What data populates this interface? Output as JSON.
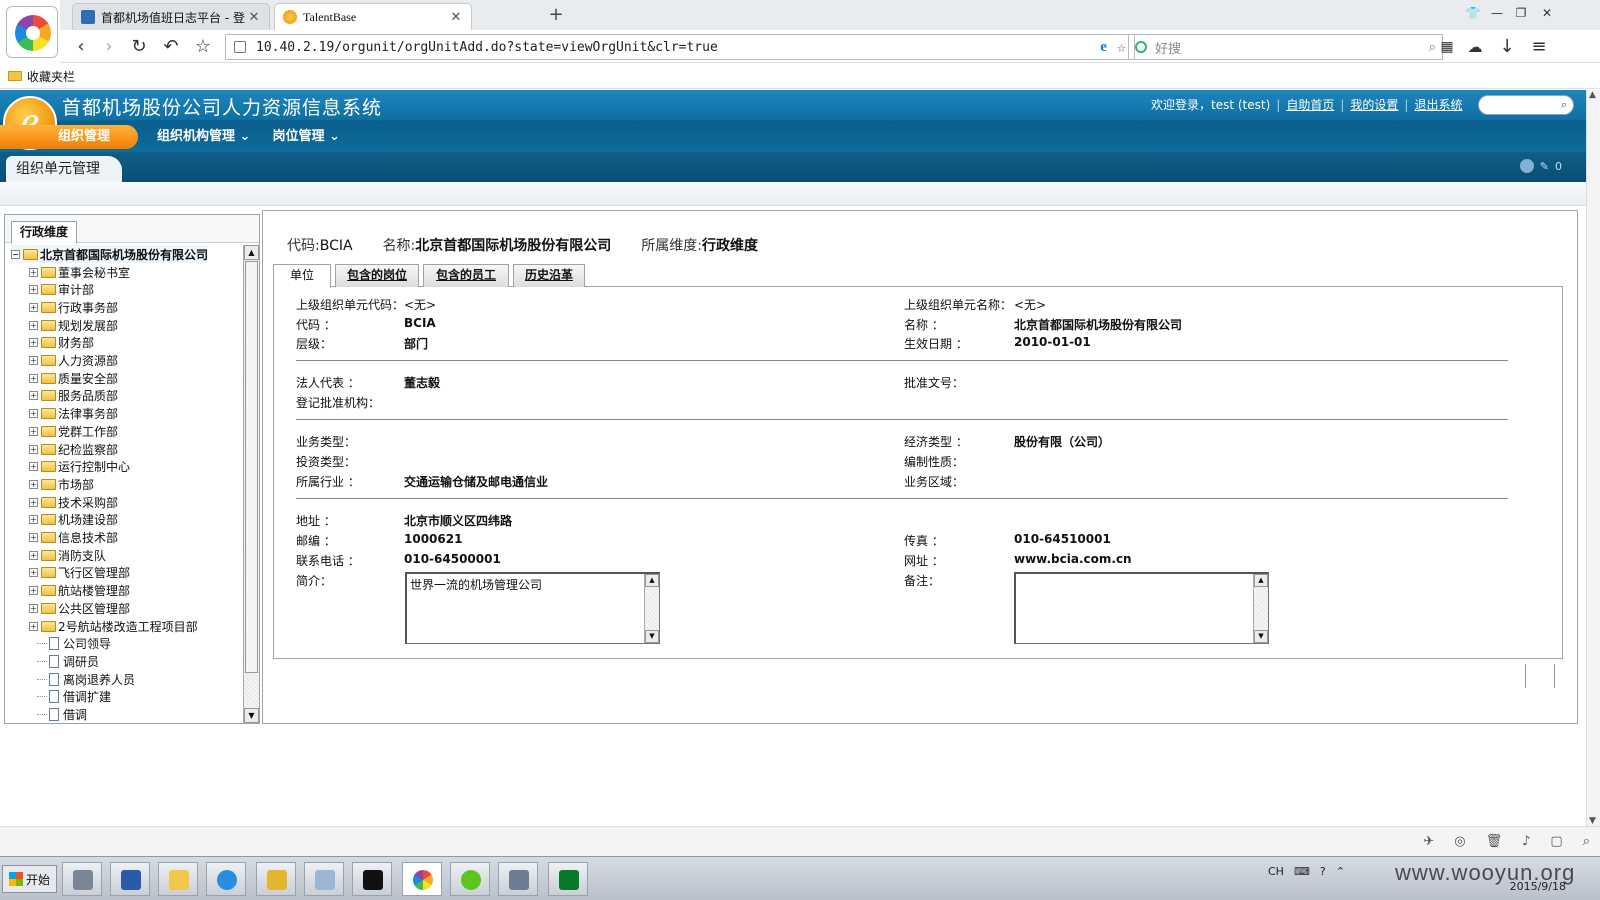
{
  "browser": {
    "tabs": [
      {
        "title": "首都机场值班日志平台 - 登",
        "active": false
      },
      {
        "title": "TalentBase",
        "active": true
      }
    ],
    "url": "10.40.2.19/orgunit/orgUnitAdd.do?state=viewOrgUnit&clr=true",
    "search_placeholder": "好搜",
    "bookmarks_label": "收藏夹栏"
  },
  "app": {
    "title": "首都机场股份公司人力资源信息系统",
    "logo_letter": "e",
    "welcome": "欢迎登录，test (test)",
    "links": [
      "自助首页",
      "我的设置",
      "退出系统"
    ],
    "menus": [
      "组织管理",
      "组织机构管理",
      "岗位管理"
    ],
    "page_title": "组织单元管理",
    "toolbar_count": "0"
  },
  "tree": {
    "tab_label": "行政维度",
    "root": "北京首都国际机场股份有限公司",
    "folders": [
      "董事会秘书室",
      "审计部",
      "行政事务部",
      "规划发展部",
      "财务部",
      "人力资源部",
      "质量安全部",
      "服务品质部",
      "法律事务部",
      "党群工作部",
      "纪检监察部",
      "运行控制中心",
      "市场部",
      "技术采购部",
      "机场建设部",
      "信息技术部",
      "消防支队",
      "飞行区管理部",
      "航站楼管理部",
      "公共区管理部",
      "2号航站楼改造工程项目部"
    ],
    "documents": [
      "公司领导",
      "调研员",
      "离岗退养人员",
      "借调扩建",
      "借调"
    ]
  },
  "summary": {
    "code_label": "代码:",
    "code": "BCIA",
    "name_label": "名称:",
    "name": "北京首都国际机场股份有限公司",
    "dim_label": "所属维度:",
    "dim": "行政维度"
  },
  "content_tabs": [
    "单位",
    "包含的岗位",
    "包含的员工",
    "历史沿革"
  ],
  "fields": {
    "parent_code_label": "上级组织单元代码：",
    "parent_code": "<无>",
    "parent_name_label": "上级组织单元名称：",
    "parent_name": "<无>",
    "code_label": "代码 ：",
    "code": "BCIA",
    "name_label": "名称 ：",
    "name": "北京首都国际机场股份有限公司",
    "level_label": "层级：",
    "level": "部门",
    "effective_label": "生效日期 ：",
    "effective": "2010-01-01",
    "legal_rep_label": "法人代表 ：",
    "legal_rep": "董志毅",
    "approval_no_label": "批准文号：",
    "approval_no": "",
    "reg_org_label": "登记批准机构：",
    "reg_org": "",
    "biz_type_label": "业务类型：",
    "biz_type": "",
    "econ_type_label": "经济类型 ：",
    "econ_type": "股份有限（公司）",
    "invest_type_label": "投资类型：",
    "invest_type": "",
    "staffing_label": "编制性质：",
    "staffing": "",
    "industry_label": "所属行业 ：",
    "industry": "交通运输仓储及邮电通信业",
    "area_label": "业务区域：",
    "area": "",
    "address_label": "地址 ：",
    "address": "北京市顺义区四纬路",
    "zip_label": "邮编 ：",
    "zip": "1000621",
    "fax_label": "传真 ：",
    "fax": "010-64510001",
    "phone_label": "联系电话 ：",
    "phone": "010-64500001",
    "website_label": "网址 ：",
    "website": "www.bcia.com.cn",
    "intro_label": "简介：",
    "intro": "世界一流的机场管理公司",
    "remark_label": "备注：",
    "remark": ""
  },
  "taskbar": {
    "start_label": "开始",
    "lang": "CH",
    "date": "2015/9/18"
  },
  "watermark": "www.wooyun.org",
  "colors": {
    "header": "#0f6fa2",
    "menu_active": "#f39a16"
  }
}
